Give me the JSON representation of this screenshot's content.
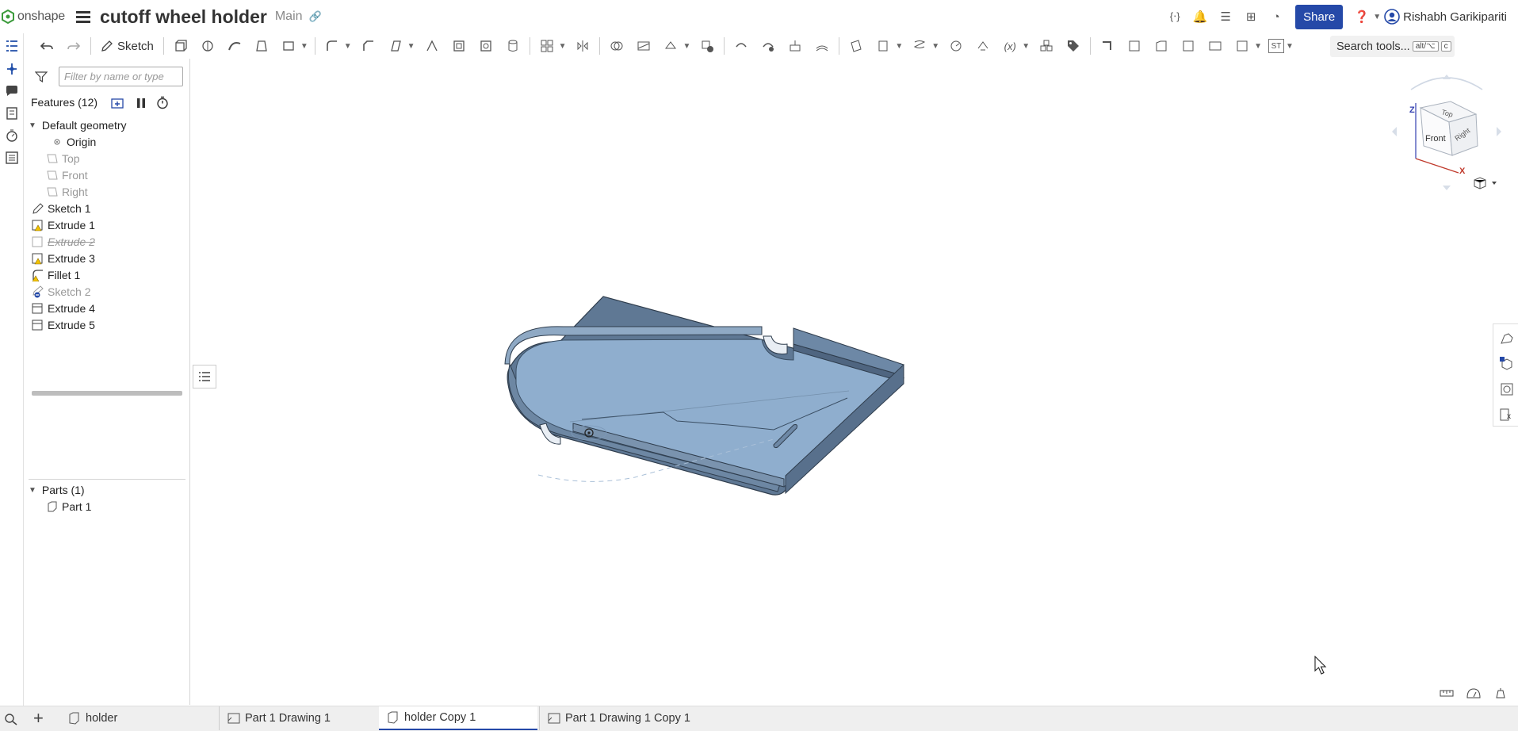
{
  "app": {
    "name": "onshape",
    "doc_title": "cutoff wheel holder",
    "branch": "Main"
  },
  "header": {
    "share_label": "Share",
    "user_name": "Rishabh Garikipariti"
  },
  "toolbar": {
    "sketch_label": "Sketch",
    "search_label": "Search tools...",
    "search_kbd1": "alt/⌥",
    "search_kbd2": "c",
    "st_label": "ST"
  },
  "panel": {
    "filter_placeholder": "Filter by name or type",
    "features_label": "Features (12)",
    "default_geometry": "Default geometry",
    "items": [
      {
        "label": "Origin"
      },
      {
        "label": "Top"
      },
      {
        "label": "Front"
      },
      {
        "label": "Right"
      },
      {
        "label": "Sketch 1"
      },
      {
        "label": "Extrude 1"
      },
      {
        "label": "Extrude 2"
      },
      {
        "label": "Extrude 3"
      },
      {
        "label": "Fillet 1"
      },
      {
        "label": "Sketch 2"
      },
      {
        "label": "Extrude 4"
      },
      {
        "label": "Extrude 5"
      }
    ],
    "parts_label": "Parts (1)",
    "part1": "Part 1"
  },
  "viewcube": {
    "top": "Top",
    "front": "Front",
    "right": "Right",
    "axis_z": "Z",
    "axis_x": "X"
  },
  "tabs": [
    {
      "label": "holder"
    },
    {
      "label": "Part 1 Drawing 1"
    },
    {
      "label": "holder Copy 1"
    },
    {
      "label": "Part 1 Drawing 1 Copy 1"
    }
  ],
  "colors": {
    "accent": "#2549a8",
    "part": "#7f9fbf",
    "warning": "#f2c200"
  }
}
